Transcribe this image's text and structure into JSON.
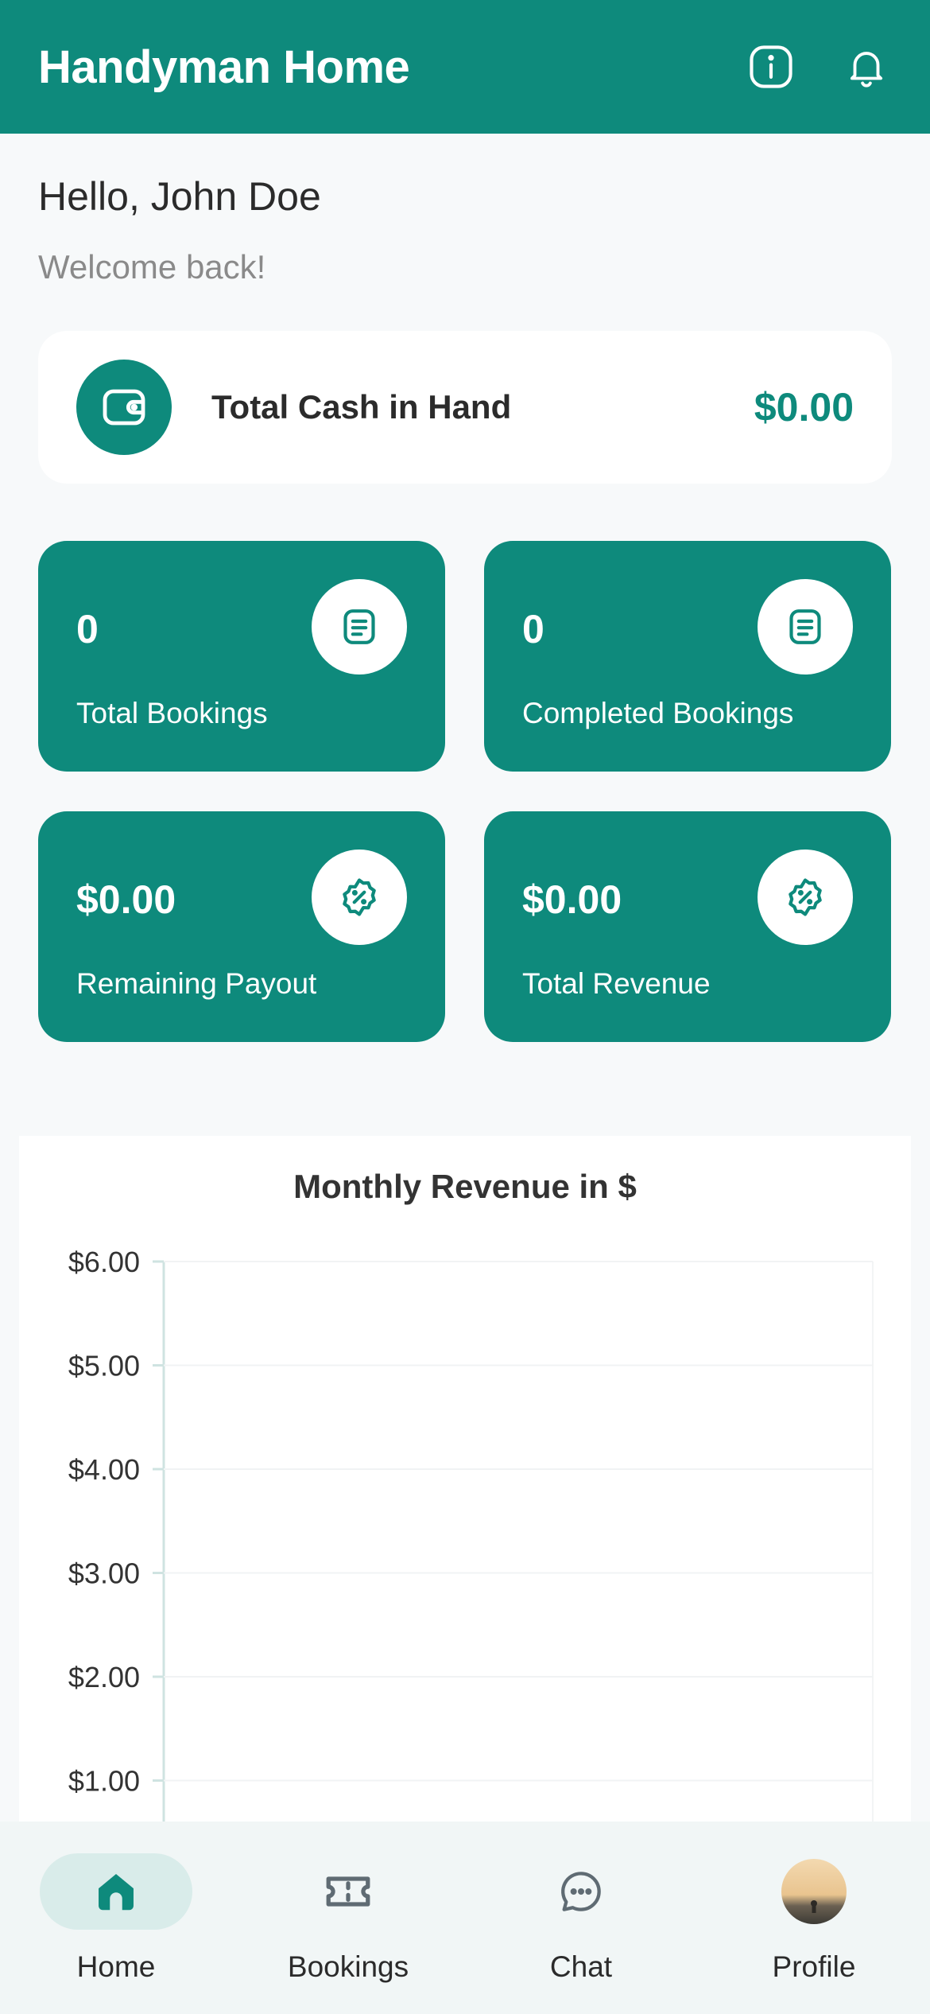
{
  "header": {
    "title": "Handyman Home",
    "info_icon": "info-icon",
    "bell_icon": "bell-icon"
  },
  "greeting": {
    "hello": "Hello, John Doe",
    "welcome": "Welcome back!"
  },
  "cash": {
    "label": "Total Cash in Hand",
    "value": "$0.00",
    "icon": "wallet-icon"
  },
  "stats": [
    {
      "value": "0",
      "label": "Total Bookings",
      "icon": "list-document-icon"
    },
    {
      "value": "0",
      "label": "Completed Bookings",
      "icon": "list-document-icon"
    },
    {
      "value": "$0.00",
      "label": "Remaining Payout",
      "icon": "discount-badge-icon"
    },
    {
      "value": "$0.00",
      "label": "Total Revenue",
      "icon": "discount-badge-icon"
    }
  ],
  "chart_data": {
    "type": "line",
    "title": "Monthly Revenue in $",
    "xlabel": "",
    "ylabel": "",
    "ylim": [
      0,
      6
    ],
    "y_ticks": [
      "$6.00",
      "$5.00",
      "$4.00",
      "$3.00",
      "$2.00",
      "$1.00"
    ],
    "y_tick_values": [
      6,
      5,
      4,
      3,
      2,
      1
    ],
    "grid": true,
    "categories": [],
    "series": []
  },
  "colors": {
    "primary": "#0e8a7c",
    "background": "#f7f9fa",
    "card": "#ffffff",
    "nav_background": "#f1f6f6",
    "nav_active_pill": "#d9ecea"
  },
  "nav": {
    "home": {
      "label": "Home",
      "icon": "home-icon"
    },
    "bookings": {
      "label": "Bookings",
      "icon": "ticket-icon"
    },
    "chat": {
      "label": "Chat",
      "icon": "chat-icon"
    },
    "profile": {
      "label": "Profile",
      "icon": "avatar"
    },
    "active": "home"
  }
}
